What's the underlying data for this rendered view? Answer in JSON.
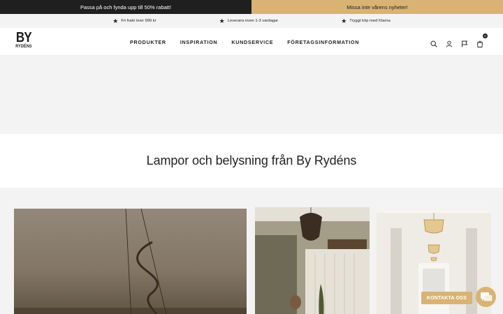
{
  "announcement": {
    "left": "Passa på och fynda upp till 50% rabatt!",
    "right": "Missa inte vårens nyheter!"
  },
  "usp": [
    {
      "icon": "star-icon",
      "text": "Fri frakt över 999 kr"
    },
    {
      "icon": "star-icon",
      "text": "Leverans inom 1-3 vardagar"
    },
    {
      "icon": "star-icon",
      "text": "Tryggt köp med Klarna"
    }
  ],
  "logo": {
    "big": "BY",
    "small": "RYDÉNS"
  },
  "nav": [
    "PRODUKTER",
    "INSPIRATION",
    "KUNDSERVICE",
    "FÖRETAGSINFORMATION"
  ],
  "header_icons": [
    "search-icon",
    "account-icon",
    "flag-icon",
    "cart-icon"
  ],
  "cart": {
    "count": "0"
  },
  "section": {
    "title": "Lampor och belysning från By Rydéns"
  },
  "contact": {
    "label": "KONTAKTA OSS"
  },
  "colors": {
    "dark": "#1f1f1f",
    "gold": "#d9b374",
    "light_gray": "#f3f3f3",
    "green_tag": "#2f6b50"
  }
}
